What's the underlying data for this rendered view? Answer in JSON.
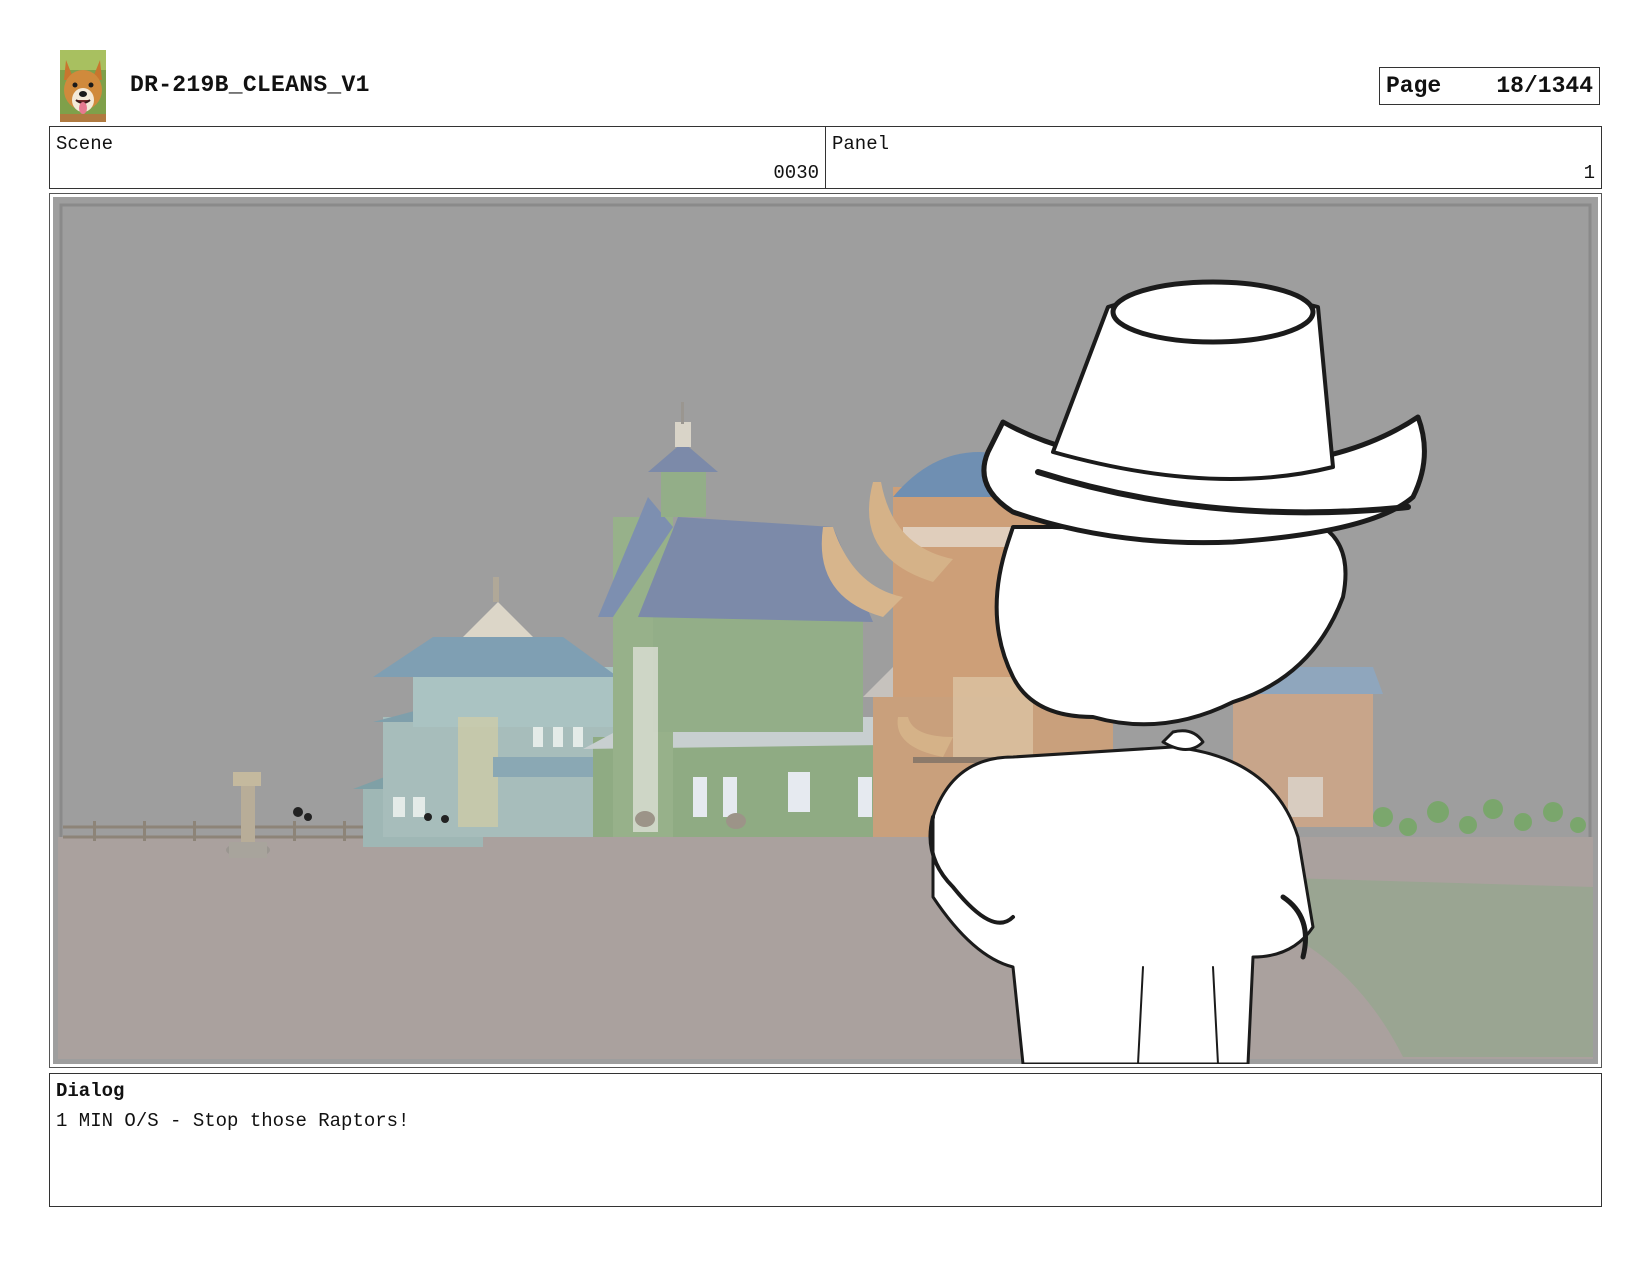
{
  "header": {
    "logo_icon": "corgi-dog-logo-icon",
    "title": "DR-219B_CLEANS_V1",
    "page_label": "Page",
    "page_number": "18/1344"
  },
  "info": {
    "scene_label": "Scene",
    "scene_value": "0030",
    "panel_label": "Panel",
    "panel_value": "1"
  },
  "panel": {
    "image": "storyboard-panel-image",
    "colors": {
      "sky": "#9e9e9e",
      "ground": "#aaa19e",
      "green_barn": "#93ae88",
      "roof_blue": "#7c8aa9",
      "orange_barn": "#c9a07c",
      "teal_house": "#9fb7b5"
    }
  },
  "dialog": {
    "label": "Dialog",
    "text": "1 MIN O/S - Stop those Raptors!"
  }
}
